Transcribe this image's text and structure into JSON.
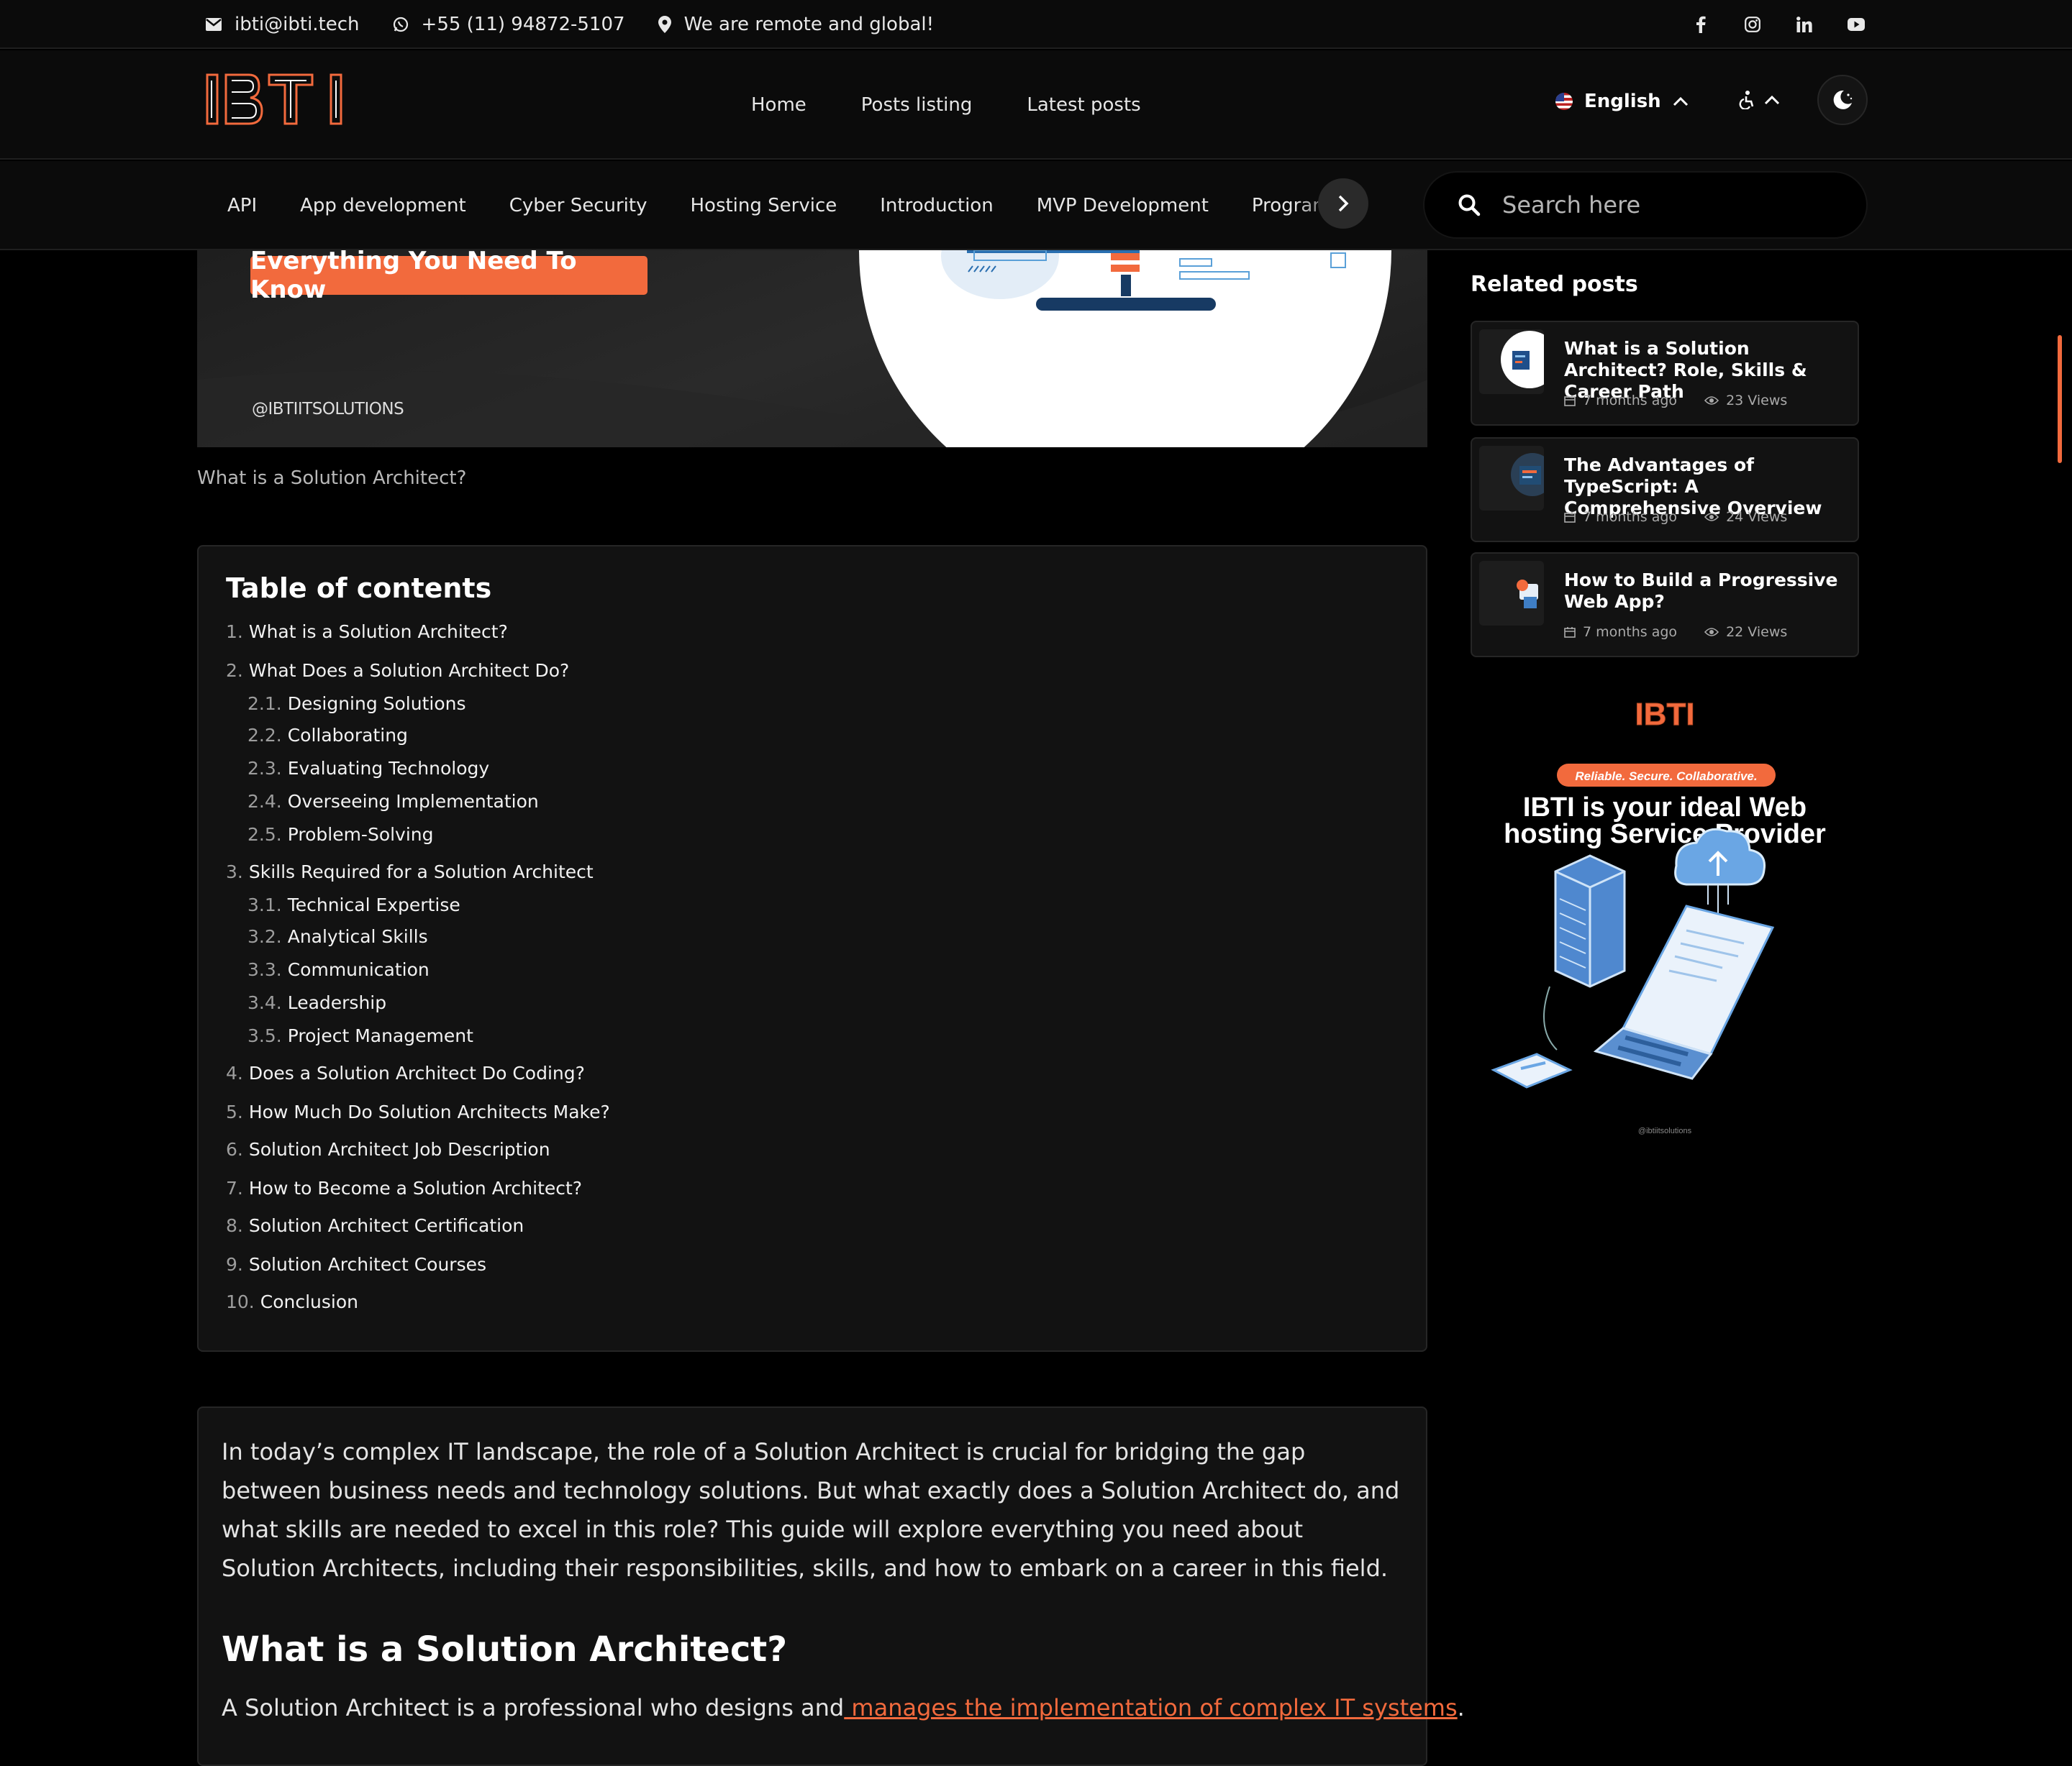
{
  "topbar": {
    "email": "ibti@ibti.tech",
    "phone": "+55 (11) 94872-5107",
    "location": "We are remote and global!",
    "social_icons": [
      "facebook-icon",
      "instagram-icon",
      "linkedin-icon",
      "youtube-icon"
    ]
  },
  "header": {
    "logo_text": "IBTI",
    "nav": [
      "Home",
      "Posts listing",
      "Latest posts"
    ],
    "language": "English"
  },
  "categories": [
    "API",
    "App development",
    "Cyber Security",
    "Hosting Service",
    "Introduction",
    "MVP Development",
    "Programming"
  ],
  "search": {
    "placeholder": "Search here"
  },
  "hero": {
    "badge": "Everything You Need To  Know",
    "handle": "@IBTIITSOLUTIONS",
    "caption": "What is a Solution Architect?"
  },
  "toc": {
    "title": "Table of contents",
    "items": [
      {
        "num": "1.",
        "label": "What is a Solution Architect?"
      },
      {
        "num": "2.",
        "label": "What Does a Solution Architect Do?"
      },
      {
        "num": "2.1.",
        "label": "Designing Solutions"
      },
      {
        "num": "2.2.",
        "label": "Collaborating"
      },
      {
        "num": "2.3.",
        "label": "Evaluating Technology"
      },
      {
        "num": "2.4.",
        "label": "Overseeing Implementation"
      },
      {
        "num": "2.5.",
        "label": "Problem-Solving"
      },
      {
        "num": "3.",
        "label": "Skills Required for a Solution Architect"
      },
      {
        "num": "3.1.",
        "label": "Technical Expertise"
      },
      {
        "num": "3.2.",
        "label": "Analytical Skills"
      },
      {
        "num": "3.3.",
        "label": "Communication"
      },
      {
        "num": "3.4.",
        "label": "Leadership"
      },
      {
        "num": "3.5.",
        "label": "Project Management"
      },
      {
        "num": "4.",
        "label": "Does a Solution Architect Do Coding?"
      },
      {
        "num": "5.",
        "label": "How Much Do Solution Architects Make?"
      },
      {
        "num": "6.",
        "label": "Solution Architect Job Description"
      },
      {
        "num": "7.",
        "label": "How to Become a Solution Architect?"
      },
      {
        "num": "8.",
        "label": "Solution Architect Certification"
      },
      {
        "num": "9.",
        "label": "Solution Architect Courses"
      },
      {
        "num": "10.",
        "label": "Conclusion"
      }
    ]
  },
  "article": {
    "intro": "In today’s complex IT landscape, the role of a Solution Architect is crucial for bridging the gap between business needs and technology solutions. But what exactly does a Solution Architect do, and what skills are needed to excel in this role? This guide will explore everything you need about Solution Architects, including their responsibilities, skills, and how to embark on a career in this field.",
    "heading": "What is a Solution Architect?",
    "lead_text": "A Solution Architect is a professional who designs and",
    "lead_link": " manages the implementation of complex IT systems",
    "lead_end": "."
  },
  "related": {
    "title": "Related posts",
    "posts": [
      {
        "title": "What is a Solution Architect? Role, Skills & Career Path",
        "date": "7 months ago",
        "views": "23 Views"
      },
      {
        "title": "The Advantages of TypeScript: A Comprehensive Overview",
        "date": "7 months ago",
        "views": "24 Views"
      },
      {
        "title": "How to Build a Progressive Web App?",
        "date": "7 months ago",
        "views": "22 Views"
      }
    ]
  },
  "ad": {
    "logo": "IBTI",
    "tagline": "Reliable. Secure. Collaborative.",
    "headline_1": "IBTI is your ideal Web",
    "headline_2": "hosting Service Provider",
    "footer": "@ibtiitsolutions"
  },
  "colors": {
    "accent": "#f26a3d",
    "background": "#000000",
    "card": "#121212"
  }
}
